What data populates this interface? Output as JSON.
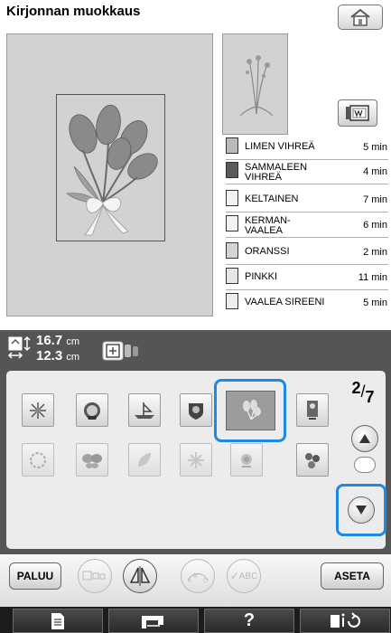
{
  "header": {
    "title": "Kirjonnan muokkaus"
  },
  "icons": {
    "home": "home-icon",
    "frame": "embroidery-frame-icon",
    "layout": "frame-layout-icon",
    "size": "size-arrows-icon"
  },
  "colors": {
    "accent": "#1e88e5",
    "panel_bg": "#d2d2d2",
    "dark_bar": "#555555",
    "nav_bg": "#1c1c1c"
  },
  "thread_list": [
    {
      "name": "LIMEN VIHREÄ",
      "time": "5 min",
      "swatch": "#b9b9b9"
    },
    {
      "name": "SAMMALEEN VIHREÄ",
      "time": "4 min",
      "swatch": "#5a5a5a"
    },
    {
      "name": "KELTAINEN",
      "time": "7 min",
      "swatch": "#f2f2f2"
    },
    {
      "name": "KERMAN- VAALEA",
      "time": "6 min",
      "swatch": "#f2f2f2"
    },
    {
      "name": "ORANSSI",
      "time": "2 min",
      "swatch": "#d4d4d4"
    },
    {
      "name": "PINKKI",
      "time": "11 min",
      "swatch": "#e6e6e6"
    },
    {
      "name": "VAALEA SIREENI",
      "time": "5 min",
      "swatch": "#eeeeee"
    }
  ],
  "size": {
    "height": "16.7",
    "width": "12.3",
    "unit": "cm"
  },
  "pagination": {
    "current": "2",
    "total": "7"
  },
  "buttons": {
    "back": "PALUU",
    "set": "ASETA",
    "abc": "ABC"
  },
  "help_glyph": "?"
}
